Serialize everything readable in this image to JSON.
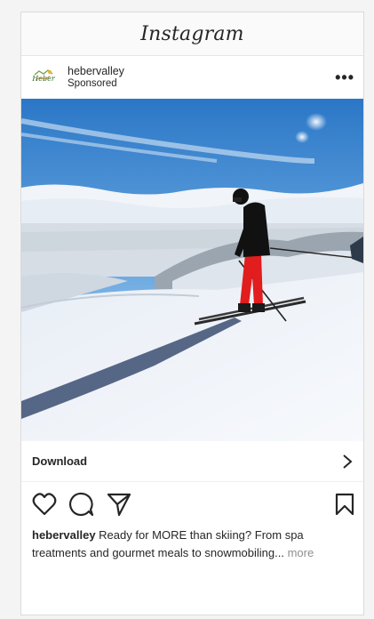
{
  "app": {
    "title": "Instagram"
  },
  "post": {
    "account": "hebervalley",
    "sponsored_label": "Sponsored",
    "avatar_text": "Heber",
    "more_label": "•••"
  },
  "cta": {
    "label": "Download",
    "chevron": "›"
  },
  "actions": {
    "icons": [
      "heart-icon",
      "comment-icon",
      "share-icon",
      "bookmark-icon"
    ]
  },
  "caption": {
    "user": "hebervalley",
    "text": "Ready for MORE than skiing? From spa treatments and gourmet meals to snowmobiling...",
    "more_label": "more"
  },
  "colors": {
    "text": "#262626",
    "muted": "#8e8e8e",
    "border": "#dbdbdb"
  }
}
